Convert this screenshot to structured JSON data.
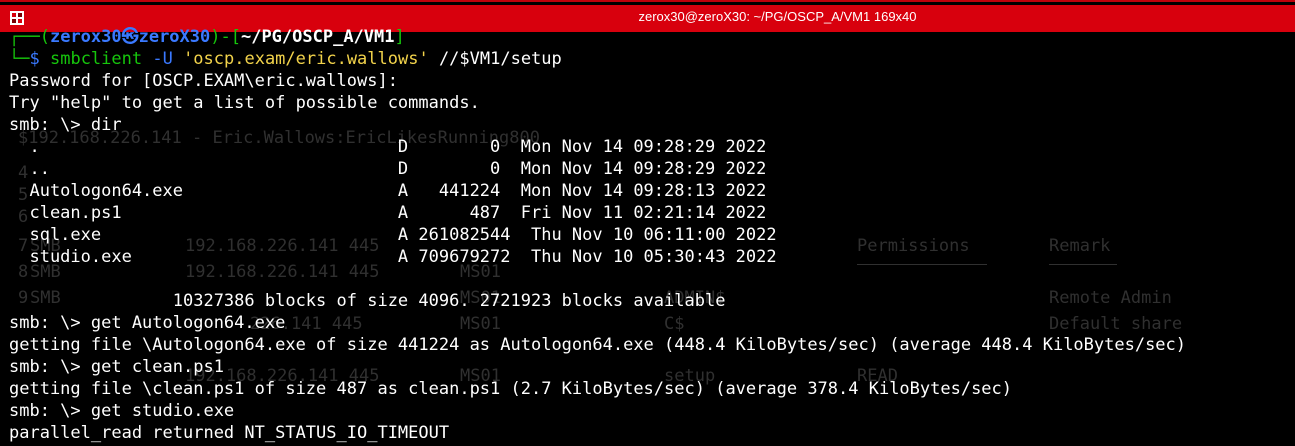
{
  "window": {
    "title": "zerox30@zeroX30: ~/PG/OSCP_A/VM1 169x40"
  },
  "prompt": {
    "bracket_open": "┌──(",
    "user_host": "zerox30㉿zeroX30",
    "bracket_mid": ")-[",
    "path": "~/PG/OSCP_A/VM1",
    "bracket_close": "]",
    "corner": "└─",
    "dollar": "$",
    "cmd_name": "smbclient",
    "cmd_flag": " -U ",
    "cmd_user": "'oscp.exam/eric.wallows'",
    "cmd_rest": " //$VM1/setup"
  },
  "lines": [
    "Password for [OSCP.EXAM\\eric.wallows]:",
    "Try \"help\" to get a list of possible commands.",
    "smb: \\> dir",
    "  .                                   D        0  Mon Nov 14 09:28:29 2022",
    "  ..                                  D        0  Mon Nov 14 09:28:29 2022",
    "  Autologon64.exe                     A   441224  Mon Nov 14 09:28:13 2022",
    "  clean.ps1                           A      487  Fri Nov 11 02:21:14 2022",
    "  sql.exe                             A 261082544  Thu Nov 10 06:11:00 2022",
    "  studio.exe                          A 709679272  Thu Nov 10 05:30:43 2022",
    "",
    "                10327386 blocks of size 4096. 2721923 blocks available",
    "smb: \\> get Autologon64.exe",
    "getting file \\Autologon64.exe of size 441224 as Autologon64.exe (448.4 KiloBytes/sec) (average 448.4 KiloBytes/sec)",
    "smb: \\> get clean.ps1",
    "getting file \\clean.ps1 of size 487 as clean.ps1 (2.7 KiloBytes/sec) (average 378.4 KiloBytes/sec)",
    "smb: \\> get studio.exe",
    "parallel_read returned NT_STATUS_IO_TIMEOUT"
  ],
  "background_ghost": {
    "line1": "$192.168.226.141 - Eric.Wallows:EricLikesRunning800",
    "perm_header": "Permissions",
    "remark_header": "Remark",
    "r7_smb": "SMB",
    "r7_ip": "192.168.226.141 445",
    "r8_smb": "SMB",
    "r8_ip": "192.168.226.141 445",
    "r8_host": "MS01",
    "r9_smb": "SMB",
    "r9_host": "MS01",
    "r9_admin": "ADMIN$",
    "remote_admin": "Remote Admin",
    "r10_ip": "226.141 445",
    "r10_host": "MS01",
    "c_dollar": "C$",
    "default_share": "Default share",
    "r12_ip": "192.168.226.141 445",
    "r12_host": "MS01",
    "setup": "setup",
    "read": "READ",
    "num4": "4",
    "num5": "5",
    "num6": "6",
    "num7": "7",
    "num8": "8",
    "num9": "9"
  },
  "colors": {
    "title_bar": "#d8000d",
    "prompt_blue": "#3a79ff",
    "prompt_green": "#16c60c",
    "string_yellow": "#f2d34b"
  }
}
